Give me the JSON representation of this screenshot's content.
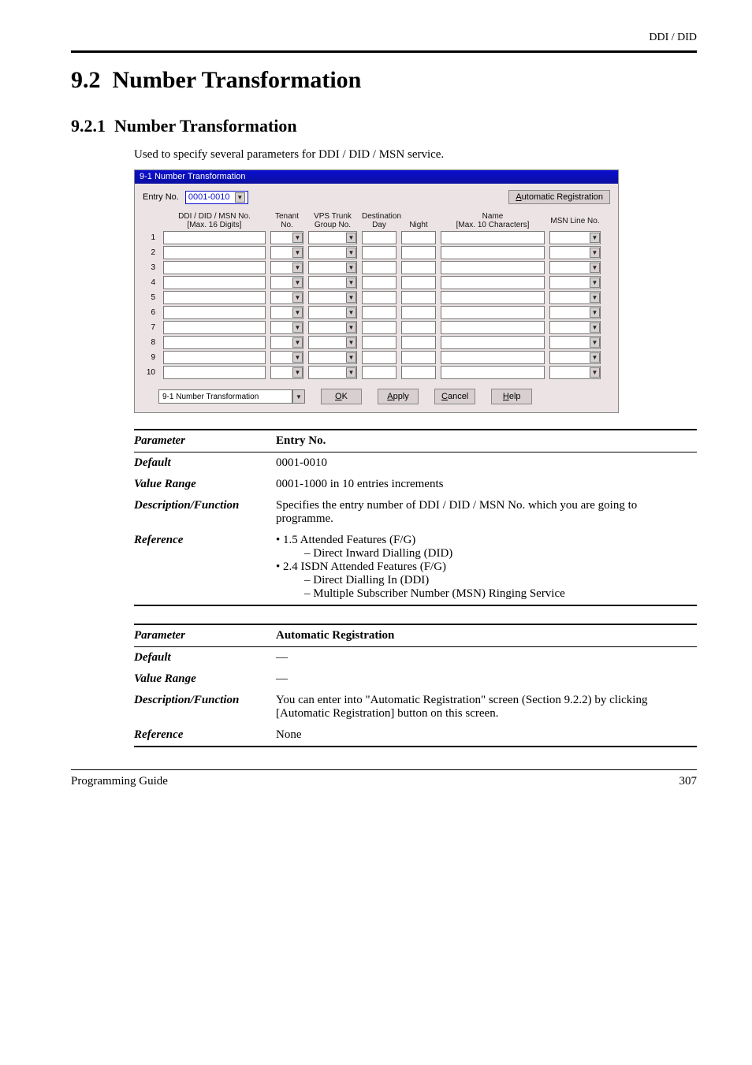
{
  "header": {
    "right": "DDI / DID"
  },
  "section": {
    "number": "9.2",
    "title": "Number Transformation",
    "sub_number": "9.2.1",
    "sub_title": "Number Transformation",
    "intro": "Used to specify several parameters for DDI / DID / MSN service."
  },
  "dialog": {
    "title": "9-1 Number Transformation",
    "entry_label": "Entry No.",
    "entry_value": "0001-0010",
    "auto_reg_button": "Automatic Registration",
    "columns": {
      "ddi": "DDI / DID / MSN No.",
      "ddi_sub": "[Max. 16 Digits]",
      "tenant": "Tenant",
      "tenant_sub": "No.",
      "vps": "VPS Trunk",
      "vps_sub": "Group No.",
      "dest": "Destination",
      "dest_day": "Day",
      "dest_night": "Night",
      "name": "Name",
      "name_sub": "[Max. 10 Characters]",
      "msn": "MSN Line No."
    },
    "rows": [
      1,
      2,
      3,
      4,
      5,
      6,
      7,
      8,
      9,
      10
    ],
    "page_nav": "9-1 Number Transformation",
    "buttons": {
      "ok": "OK",
      "apply": "Apply",
      "cancel": "Cancel",
      "help": "Help"
    }
  },
  "param1": {
    "parameter_label": "Parameter",
    "parameter_value": "Entry No.",
    "default_label": "Default",
    "default_value": "0001-0010",
    "range_label": "Value Range",
    "range_value": "0001-1000 in 10 entries increments",
    "desc_label": "Description/Function",
    "desc_value": "Specifies the entry number of DDI / DID / MSN No. which you are going to programme.",
    "ref_label": "Reference",
    "refs": [
      "• 1.5 Attended Features (F/G)",
      "– Direct Inward Dialling (DID)",
      "• 2.4 ISDN Attended Features (F/G)",
      "– Direct Dialling In (DDI)",
      "– Multiple Subscriber Number (MSN) Ringing Service"
    ]
  },
  "param2": {
    "parameter_label": "Parameter",
    "parameter_value": "Automatic Registration",
    "default_label": "Default",
    "default_value": "—",
    "range_label": "Value Range",
    "range_value": "—",
    "desc_label": "Description/Function",
    "desc_value": "You can enter into \"Automatic Registration\" screen (Section 9.2.2) by clicking [Automatic Registration] button on this screen.",
    "ref_label": "Reference",
    "ref_value": "None"
  },
  "footer": {
    "left": "Programming Guide",
    "right": "307"
  }
}
